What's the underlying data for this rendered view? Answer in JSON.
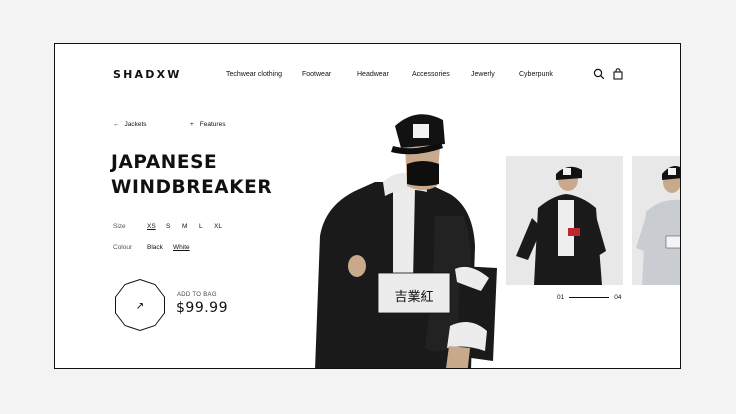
{
  "brand": {
    "logo": "SHADXW"
  },
  "nav": {
    "items": [
      {
        "label": "Techwear clothing"
      },
      {
        "label": "Footwear"
      },
      {
        "label": "Headwear"
      },
      {
        "label": "Accessories"
      },
      {
        "label": "Jewerly"
      },
      {
        "label": "Cyberpunk"
      }
    ],
    "icons": [
      "search-icon",
      "bag-icon"
    ]
  },
  "breadcrumb": {
    "back_label": "Jackets",
    "back_arrow": "←",
    "features_label": "Features",
    "features_plus": "+"
  },
  "product": {
    "title_line1": "JAPANESE",
    "title_line2": "WINDBREAKER",
    "size_label": "Size",
    "sizes": [
      "XS",
      "S",
      "M",
      "L",
      "XL"
    ],
    "colour_label": "Colour",
    "colours": [
      "Black",
      "White"
    ],
    "selected_colour": "White",
    "add_label": "ADD TO BAG",
    "add_arrow": "↗",
    "price": "$99.99",
    "patch_text": "吉業紅"
  },
  "gallery": {
    "current": "01",
    "total": "04"
  },
  "colors": {
    "frame_bg": "#ffffff",
    "page_bg": "#f3f3f3",
    "ink": "#111111",
    "jacket": "#1a1a1a",
    "white_panel": "#ededed"
  }
}
